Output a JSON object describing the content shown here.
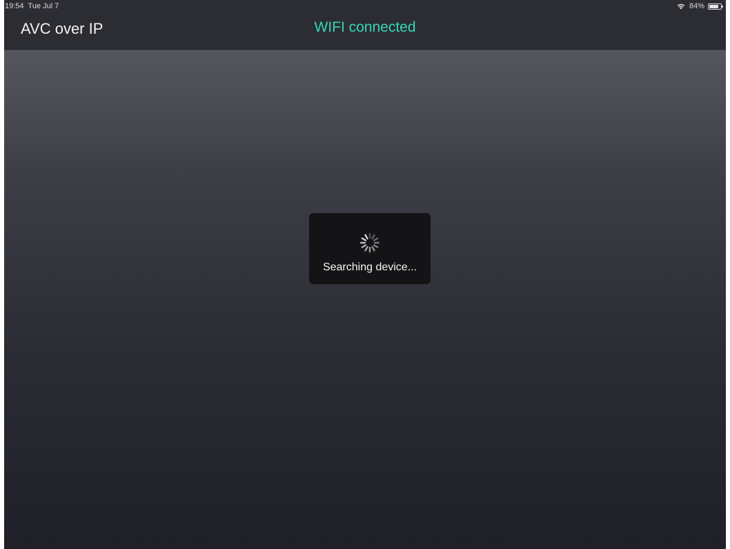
{
  "status_bar": {
    "time": "19:54",
    "date": "Tue Jul 7",
    "battery": "84%",
    "battery_level": 0.84,
    "wifi_icon": "wifi-icon",
    "battery_icon": "battery-icon"
  },
  "navbar": {
    "title": "AVC over IP",
    "connection_status": "WIFI connected",
    "connection_status_color": "#36d6b4"
  },
  "hud": {
    "spinner_icon": "activity-spinner-icon",
    "message": "Searching device..."
  }
}
